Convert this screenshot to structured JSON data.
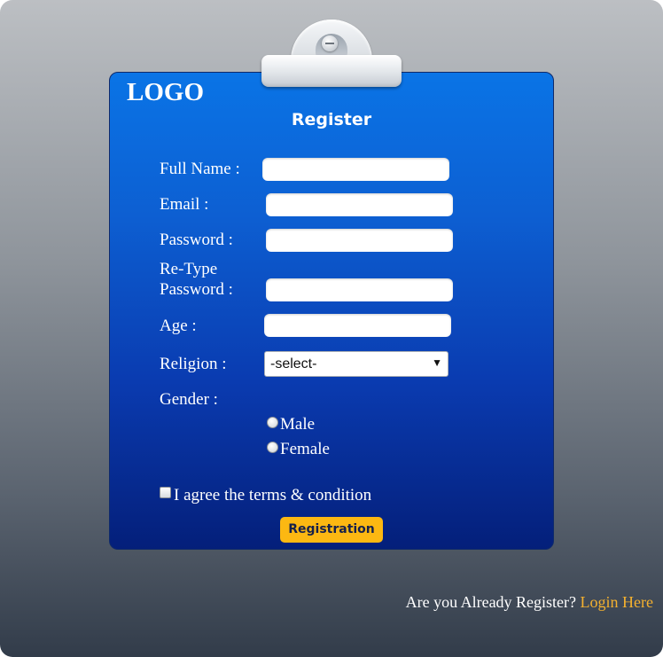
{
  "logo": "LOGO",
  "title": "Register",
  "form": {
    "full_name_label": "Full Name :",
    "email_label": "Email :",
    "password_label": "Password :",
    "retype_label_line1": "Re-Type",
    "retype_label_line2": "Password :",
    "age_label": "Age :",
    "religion_label": "Religion :",
    "religion_selected": "-select-",
    "gender_label": "Gender :",
    "gender_options": [
      "Male",
      "Female"
    ],
    "terms_label": "I agree the terms & condition",
    "submit_label": "Registration"
  },
  "footer": {
    "question": "Are you Already Register?",
    "login_link": "Login Here"
  },
  "colors": {
    "accent": "#fcb812",
    "board_top": "#0a74e6",
    "board_bottom": "#041f7a",
    "link": "#f4b12f"
  },
  "icons": {
    "dropdown": "triangle-down-icon"
  }
}
